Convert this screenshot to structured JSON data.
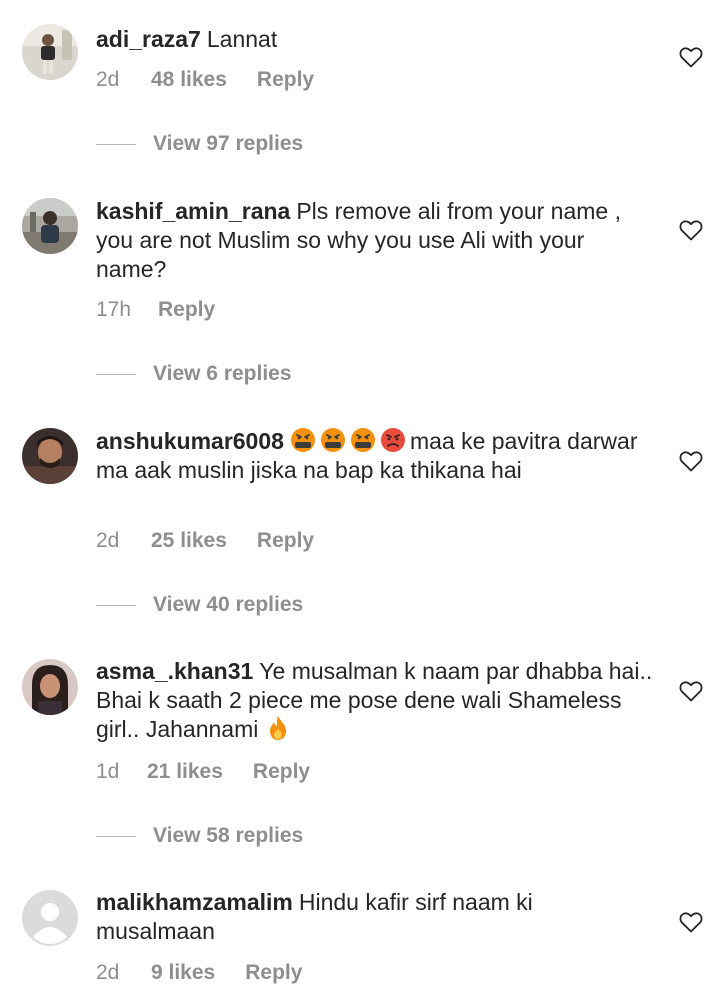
{
  "icons": {
    "like": "heart-outline-icon",
    "avatar_placeholder": "default-avatar-icon",
    "emoji_cursing": "face-with-symbols-on-mouth-emoji",
    "emoji_angry": "angry-face-emoji",
    "emoji_fire": "fire-emoji"
  },
  "colors": {
    "text": "#262626",
    "muted": "#8e8e8e",
    "angry": "#e84a3c",
    "cursing": "#f4900c",
    "fire": "#f4900c"
  },
  "comments": [
    {
      "username": "adi_raza7",
      "text": "Lannat",
      "time": "2d",
      "likes": "48 likes",
      "reply": "Reply",
      "view_replies": "View 97 replies"
    },
    {
      "username": "kashif_amin_rana",
      "text": "Pls remove ali from your name , you are not Muslim so why you use Ali with your name?",
      "time": "17h",
      "reply": "Reply",
      "view_replies": "View 6 replies"
    },
    {
      "username": "anshukumar6008",
      "text": "maa ke pavitra darwar ma aak muslin jiska na bap ka thikana hai",
      "time": "2d",
      "likes": "25 likes",
      "reply": "Reply",
      "view_replies": "View 40 replies"
    },
    {
      "username": "asma_.khan31",
      "text": "Ye musalman k naam par dhabba hai.. Bhai k saath 2 piece me pose dene wali Shameless girl.. Jahannami",
      "time": "1d",
      "likes": "21 likes",
      "reply": "Reply",
      "view_replies": "View 58 replies"
    },
    {
      "username": "malikhamzamalim",
      "text": "Hindu kafir sirf naam ki musalmaan",
      "time": "2d",
      "likes": "9 likes",
      "reply": "Reply"
    }
  ]
}
